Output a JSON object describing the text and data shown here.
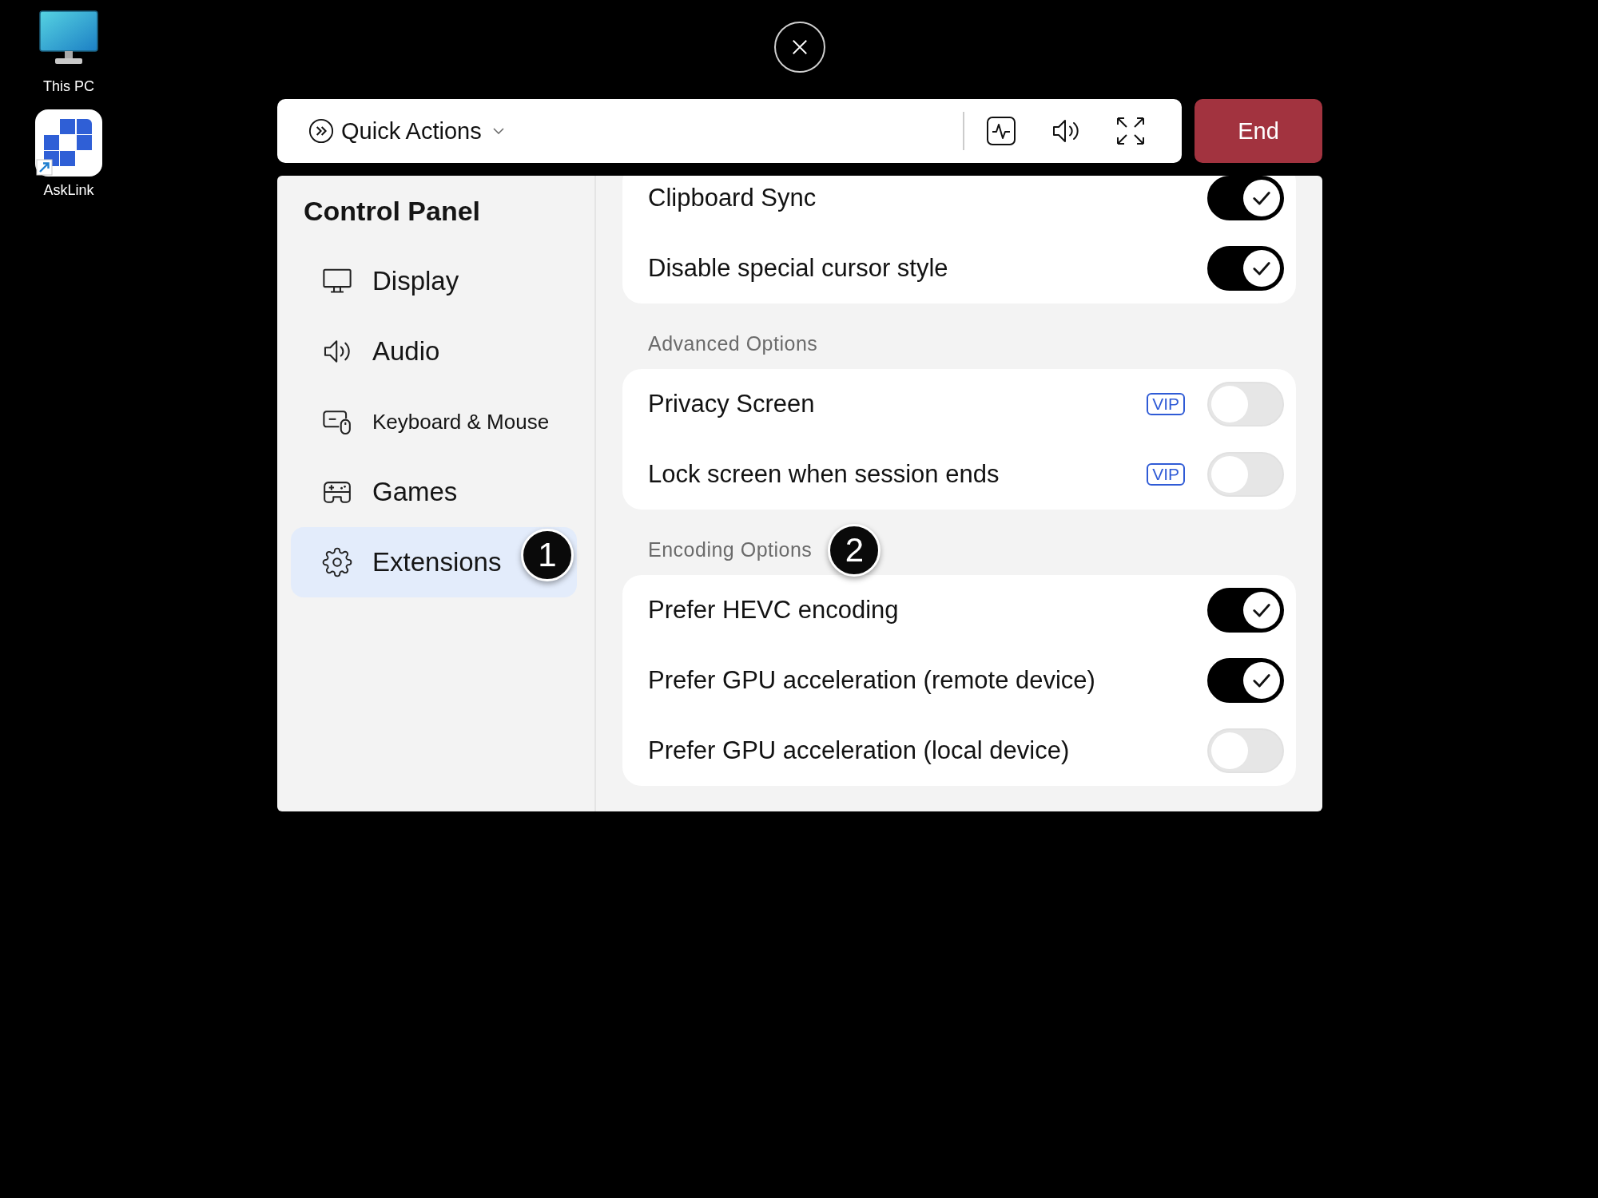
{
  "desktop": {
    "shortcuts": [
      {
        "label": "This PC"
      },
      {
        "label": "AskLink"
      }
    ]
  },
  "toolbar": {
    "quick_actions": "Quick Actions",
    "end_button": "End"
  },
  "sidebar": {
    "title": "Control Panel",
    "items": [
      {
        "label": "Display",
        "selected": false
      },
      {
        "label": "Audio",
        "selected": false
      },
      {
        "label": "Keyboard & Mouse",
        "selected": false
      },
      {
        "label": "Games",
        "selected": false
      },
      {
        "label": "Extensions",
        "selected": true,
        "marker": "1"
      }
    ]
  },
  "sections": [
    {
      "items": [
        {
          "label": "Clipboard Sync",
          "on": true
        },
        {
          "label": "Disable special cursor style",
          "on": true
        }
      ]
    },
    {
      "title": "Advanced Options",
      "items": [
        {
          "label": "Privacy Screen",
          "badge": "VIP",
          "on": false
        },
        {
          "label": "Lock screen when session ends",
          "badge": "VIP",
          "on": false
        }
      ]
    },
    {
      "title": "Encoding Options",
      "marker": "2",
      "items": [
        {
          "label": "Prefer HEVC encoding",
          "on": true
        },
        {
          "label": "Prefer GPU acceleration (remote device)",
          "on": true
        },
        {
          "label": "Prefer GPU acceleration (local device)",
          "on": false
        }
      ]
    }
  ]
}
